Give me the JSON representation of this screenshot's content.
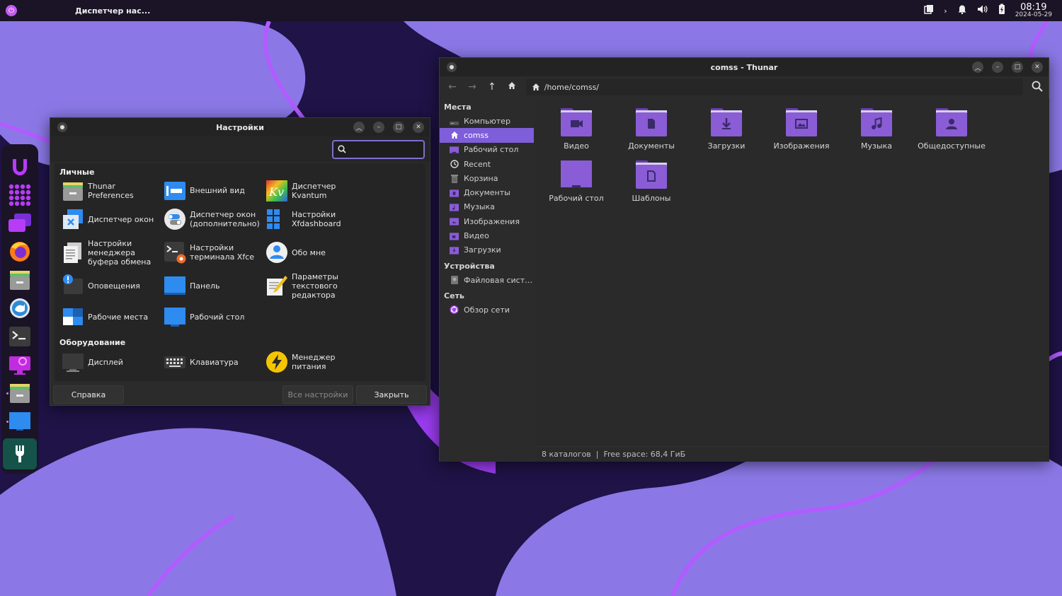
{
  "topbar": {
    "active_window_title": "Диспетчер нас...",
    "time": "08:19",
    "date": "2024-05-29"
  },
  "colors": {
    "accent": "#7e5ed9",
    "folder": "#8a5cd6",
    "panel_bg": "#1a1426"
  },
  "settings_window": {
    "title": "Настройки",
    "search_placeholder": "",
    "sections": [
      {
        "title": "Личные",
        "items": [
          {
            "label": "Thunar Preferences",
            "icon": "thunar-prefs-icon"
          },
          {
            "label": "Внешний вид",
            "icon": "appearance-icon"
          },
          {
            "label": "Диспетчер Kvantum",
            "icon": "kvantum-icon"
          },
          {
            "label": "Диспетчер окон",
            "icon": "window-manager-icon"
          },
          {
            "label": "Диспетчер окон (дополнительно)",
            "icon": "window-manager-tweaks-icon"
          },
          {
            "label": "Настройки Xfdashboard",
            "icon": "xfdashboard-icon"
          },
          {
            "label": "Настройки менеджера буфера обмена",
            "icon": "clipboard-icon"
          },
          {
            "label": "Настройки терминала Xfce",
            "icon": "terminal-settings-icon"
          },
          {
            "label": "Обо мне",
            "icon": "about-me-icon"
          },
          {
            "label": "Оповещения",
            "icon": "notifications-icon"
          },
          {
            "label": "Панель",
            "icon": "panel-icon"
          },
          {
            "label": "Параметры текстового редактора",
            "icon": "text-editor-icon"
          },
          {
            "label": "Рабочие места",
            "icon": "workspaces-icon"
          },
          {
            "label": "Рабочий стол",
            "icon": "desktop-icon"
          }
        ]
      },
      {
        "title": "Оборудование",
        "items": [
          {
            "label": "Дисплей",
            "icon": "display-icon"
          },
          {
            "label": "Клавиатура",
            "icon": "keyboard-icon"
          },
          {
            "label": "Менеджер питания",
            "icon": "power-manager-icon"
          }
        ]
      }
    ],
    "help_button": "Справка",
    "all_settings_button": "Все настройки",
    "close_button": "Закрыть"
  },
  "thunar_window": {
    "title": "comss - Thunar",
    "location": "/home/comss/",
    "sidebar": {
      "places_header": "Места",
      "places": [
        {
          "label": "Компьютер",
          "icon": "computer-icon"
        },
        {
          "label": "comss",
          "icon": "home-icon"
        },
        {
          "label": "Рабочий стол",
          "icon": "desktop-folder-icon"
        },
        {
          "label": "Recent",
          "icon": "recent-icon"
        },
        {
          "label": "Корзина",
          "icon": "trash-icon"
        },
        {
          "label": "Документы",
          "icon": "documents-folder-icon"
        },
        {
          "label": "Музыка",
          "icon": "music-folder-icon"
        },
        {
          "label": "Изображения",
          "icon": "pictures-folder-icon"
        },
        {
          "label": "Видео",
          "icon": "videos-folder-icon"
        },
        {
          "label": "Загрузки",
          "icon": "downloads-folder-icon"
        }
      ],
      "devices_header": "Устройства",
      "devices": [
        {
          "label": "Файловая сист…",
          "icon": "drive-icon"
        }
      ],
      "network_header": "Сеть",
      "network": [
        {
          "label": "Обзор сети",
          "icon": "network-icon"
        }
      ]
    },
    "files": [
      {
        "label": "Видео",
        "icon": "video-folder-icon"
      },
      {
        "label": "Документы",
        "icon": "document-folder-icon"
      },
      {
        "label": "Загрузки",
        "icon": "download-folder-icon"
      },
      {
        "label": "Изображения",
        "icon": "image-folder-icon"
      },
      {
        "label": "Музыка",
        "icon": "music-folder-icon"
      },
      {
        "label": "Общедоступные",
        "icon": "public-folder-icon"
      },
      {
        "label": "Рабочий стол",
        "icon": "desktop-folder-icon"
      },
      {
        "label": "Шаблоны",
        "icon": "templates-folder-icon"
      }
    ],
    "status": "8 каталогов  |  Free space: 68,4 ГиБ"
  }
}
